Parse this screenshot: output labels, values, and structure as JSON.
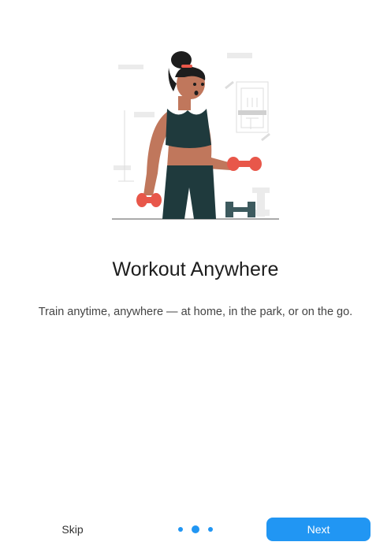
{
  "onboarding": {
    "title": "Workout Anywhere",
    "subtitle": "Train anytime, anywhere — at home, in the park, or on the go.",
    "illustration": "woman-lifting-dumbbells-illustration"
  },
  "navigation": {
    "skip_label": "Skip",
    "next_label": "Next",
    "page_count": 3,
    "current_page": 2
  },
  "colors": {
    "accent": "#2196f3",
    "title_text": "#1d1d1d",
    "body_text": "#444444",
    "background": "#ffffff",
    "skin": "#c0775c",
    "outfit": "#1f3a3d",
    "dumbbell": "#e8574a"
  }
}
